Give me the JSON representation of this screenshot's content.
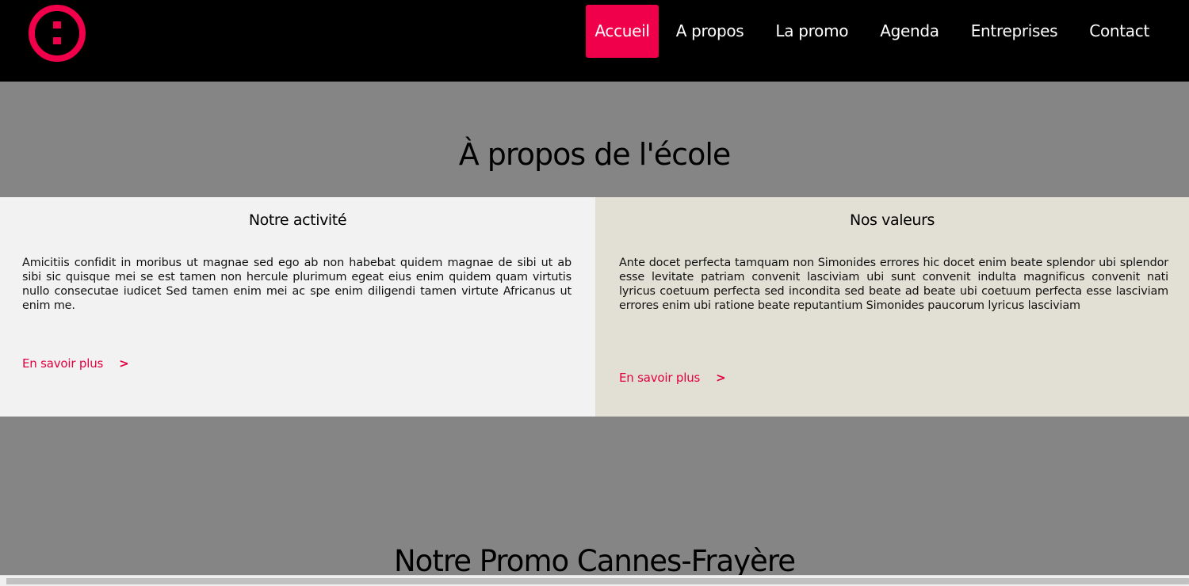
{
  "brand": {
    "logo_icon": "colon-circle-logo",
    "accent_color": "#f0004a"
  },
  "nav": {
    "items": [
      {
        "label": "Accueil",
        "active": true
      },
      {
        "label": "A propos"
      },
      {
        "label": "La promo"
      },
      {
        "label": "Agenda"
      },
      {
        "label": "Entreprises"
      },
      {
        "label": "Contact"
      }
    ]
  },
  "about": {
    "title": "À propos de l'école",
    "columns": [
      {
        "title": "Notre activité",
        "text": "Amicitiis confidit in moribus ut magnae sed ego ab non habebat quidem magnae de sibi ut ab sibi sic quisque mei se est tamen non hercule plurimum egeat eius enim quidem quam virtutis nullo consecutae iudicet Sed tamen enim mei ac spe enim diligendi tamen virtute Africanus ut enim me.",
        "link_label": "En savoir plus",
        "link_arrow": ">"
      },
      {
        "title": "Nos valeurs",
        "text": "Ante docet perfecta tamquam non Simonides errores hic docet enim beate splendor ubi splendor esse levitate patriam convenit lasciviam ubi sunt convenit indulta magnificus convenit nati lyricus coetuum perfecta sed incondita sed beate ad beate ubi coetuum perfecta esse lasciviam errores enim ubi ratione beate reputantium Simonides paucorum lyricus lasciviam",
        "link_label": "En savoir plus",
        "link_arrow": ">"
      }
    ]
  },
  "promo": {
    "title": "Notre Promo Cannes-Frayère"
  }
}
